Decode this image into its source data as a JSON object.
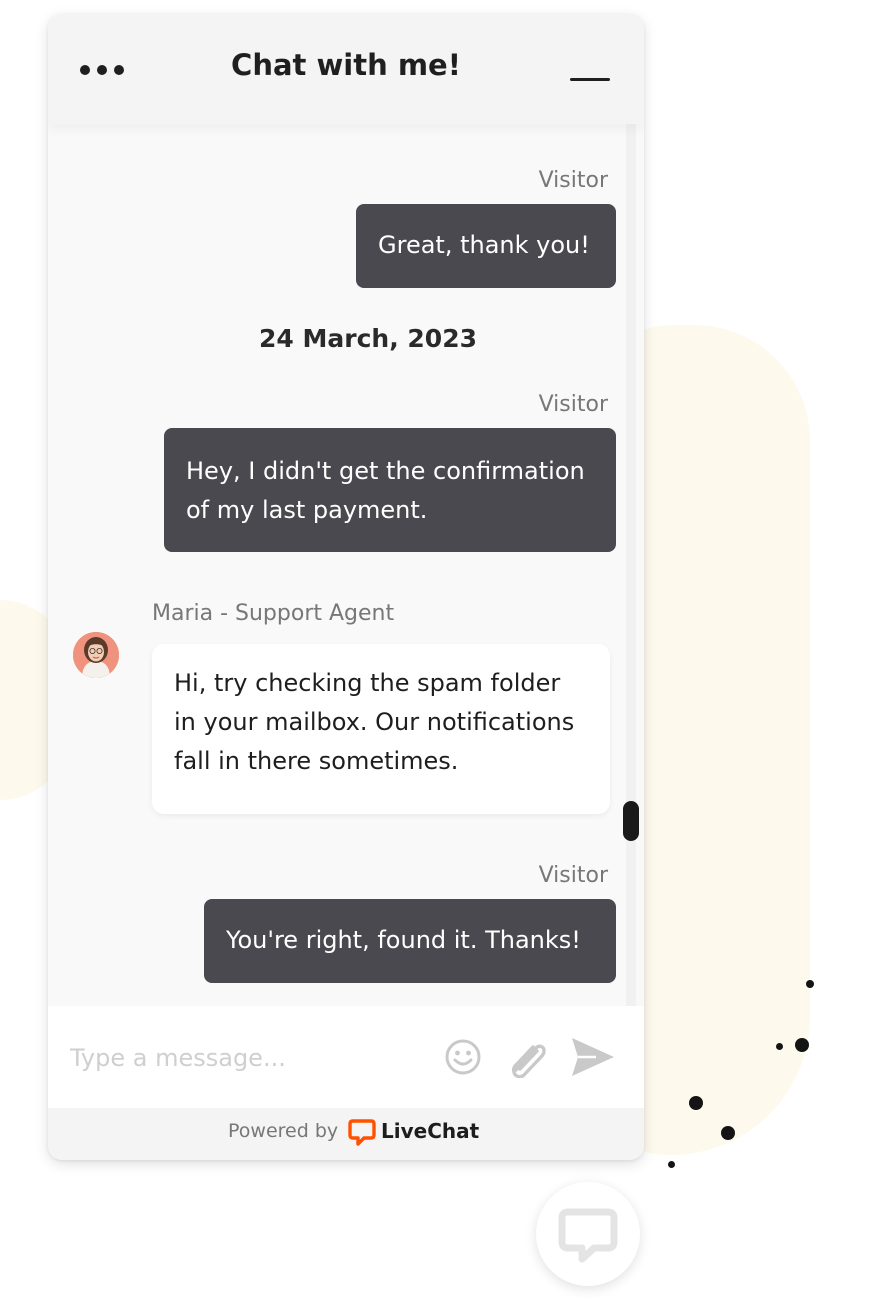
{
  "header": {
    "title": "Chat with me!",
    "menu_icon": "ellipsis-icon",
    "minimize_icon": "minimize-icon"
  },
  "messages": [
    {
      "author": "Visitor",
      "text": "Great, thank you!",
      "type": "visitor"
    },
    {
      "date_separator": "24 March, 2023"
    },
    {
      "author": "Visitor",
      "lines": [
        "Hey, I didn't get the confirmation",
        "of my last payment."
      ],
      "type": "visitor"
    },
    {
      "author": "Maria - Support Agent",
      "lines": [
        "Hi, try checking the spam folder",
        "in your mailbox. Our notifications",
        "fall in there sometimes."
      ],
      "type": "agent"
    },
    {
      "author": "Visitor",
      "text": "You're right, found it. Thanks!",
      "type": "visitor"
    }
  ],
  "composer": {
    "placeholder": "Type a message...",
    "emoji_icon": "emoji-icon",
    "attach_icon": "paperclip-icon",
    "send_icon": "send-icon"
  },
  "footer": {
    "powered_by": "Powered by",
    "brand": "LiveChat"
  },
  "colors": {
    "visitor_bubble": "#4a4950",
    "agent_bubble": "#ffffff",
    "brand_orange": "#ff5100",
    "background_blob": "#fdf9ec"
  }
}
